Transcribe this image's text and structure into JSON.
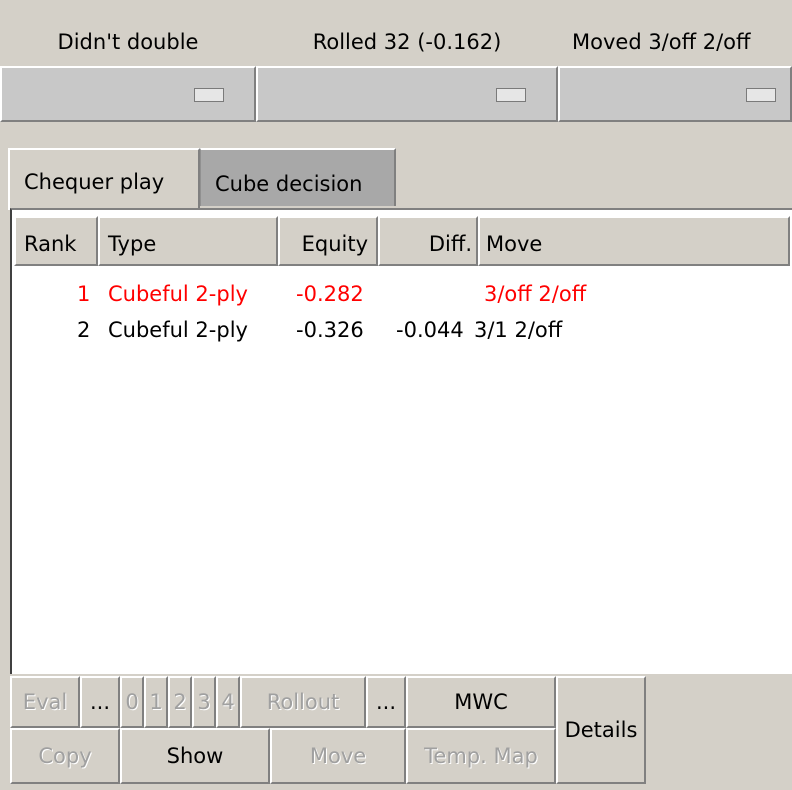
{
  "status": {
    "double_label": "Didn't double",
    "roll_label": "Rolled 32 (-0.162)",
    "move_label": "Moved 3/off 2/off"
  },
  "tabs": {
    "chequer": "Chequer play",
    "cube": "Cube decision"
  },
  "table": {
    "headers": {
      "rank": "Rank",
      "type": "Type",
      "equity": "Equity",
      "diff": "Diff.",
      "move": "Move"
    },
    "rows": [
      {
        "rank": "1",
        "type": "Cubeful 2-ply",
        "equity": "-0.282",
        "diff": "",
        "move": "3/off 2/off"
      },
      {
        "rank": "2",
        "type": "Cubeful 2-ply",
        "equity": "-0.326",
        "diff": "-0.044",
        "move": "3/1 2/off"
      }
    ]
  },
  "buttons": {
    "eval": "Eval",
    "eval_more": "...",
    "ply0": "0",
    "ply1": "1",
    "ply2": "2",
    "ply3": "3",
    "ply4": "4",
    "rollout": "Rollout",
    "rollout_more": "...",
    "mwc": "MWC",
    "details": "Details",
    "copy": "Copy",
    "show": "Show",
    "move": "Move",
    "temp_map": "Temp. Map"
  },
  "colors": {
    "best_move": "#ff0000",
    "background": "#d4d0c8"
  }
}
